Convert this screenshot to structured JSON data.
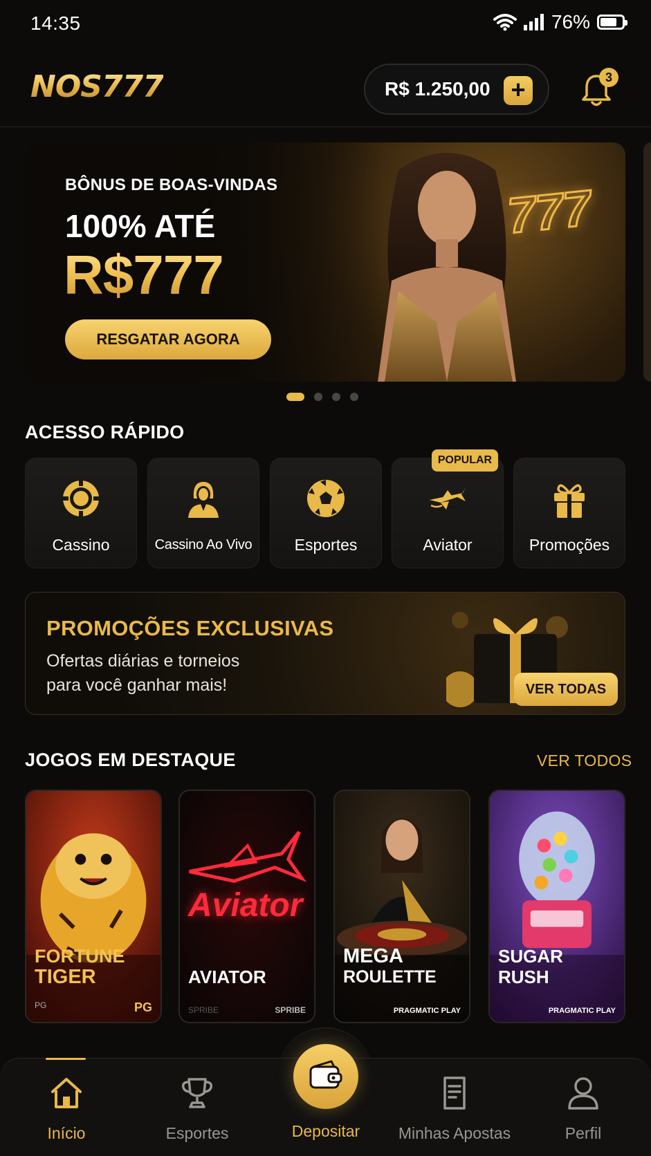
{
  "status_bar": {
    "time": "14:35",
    "battery": "76%",
    "battery_level": 0.76
  },
  "header": {
    "logo": "NOS777",
    "balance": "R$ 1.250,00",
    "add_funds": "+",
    "notifications_count": "3"
  },
  "hero": {
    "eyebrow": "BÔNUS DE BOAS-VINDAS",
    "line1": "100% ATÉ",
    "line2": "R$777",
    "cta": "RESGATAR AGORA",
    "sign": "777",
    "dots_total": 4,
    "dots_active": 1
  },
  "quick_access": {
    "title": "ACESSO RÁPIDO",
    "items": [
      {
        "label": "Cassino",
        "icon": "casino-chip-icon"
      },
      {
        "label": "Cassino Ao Vivo",
        "icon": "live-dealer-icon"
      },
      {
        "label": "Esportes",
        "icon": "soccer-ball-icon"
      },
      {
        "label": "Aviator",
        "icon": "airplane-icon",
        "badge": "POPULAR"
      },
      {
        "label": "Promoções",
        "icon": "gift-icon"
      }
    ]
  },
  "promo": {
    "title": "PROMOÇÕES EXCLUSIVAS",
    "subtitle": "Ofertas diárias e torneios para você ganhar mais!",
    "button": "VER TODAS"
  },
  "featured": {
    "title": "JOGOS EM DESTAQUE",
    "see_all": "VER TODOS",
    "games": [
      {
        "name_line1": "FORTUNE",
        "name_line2": "TIGER",
        "provider_left": "PG",
        "provider_right": "PG"
      },
      {
        "name_line1": "AVIATOR",
        "name_line2": "",
        "art_text": "Aviator",
        "provider_left": "SPRIBE",
        "provider_right": "SPRIBE"
      },
      {
        "name_line1": "MEGA",
        "name_line2": "ROULETTE",
        "provider_left": "",
        "provider_right": "PRAGMATIC PLAY"
      },
      {
        "name_line1": "SUGAR",
        "name_line2": "RUSH",
        "provider_left": "",
        "provider_right": "PRAGMATIC PLAY"
      }
    ]
  },
  "bottom_nav": {
    "items": [
      {
        "label": "Início",
        "icon": "home-icon",
        "active": true
      },
      {
        "label": "Esportes",
        "icon": "trophy-icon"
      },
      {
        "label": "Depositar",
        "icon": "wallet-icon"
      },
      {
        "label": "Minhas Apostas",
        "icon": "bet-slip-icon"
      },
      {
        "label": "Perfil",
        "icon": "user-icon"
      }
    ]
  },
  "colors": {
    "accent": "#e9b949",
    "background": "#0c0b0a",
    "card": "#1a1917"
  }
}
